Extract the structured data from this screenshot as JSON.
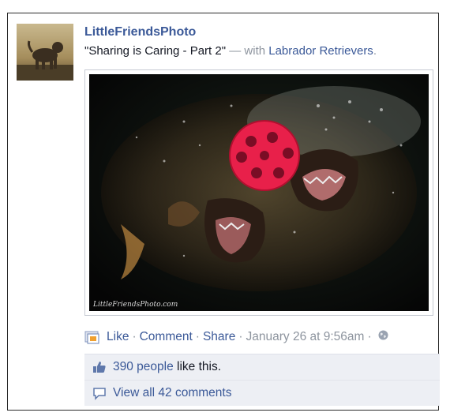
{
  "post": {
    "author": "LittleFriendsPhoto",
    "caption_quote": "\"Sharing is Caring - Part 2\"",
    "caption_with": "— with",
    "tagged_page": "Labrador Retrievers",
    "caption_end": ".",
    "photo_watermark": "LittleFriendsPhoto.com"
  },
  "actions": {
    "like": "Like",
    "comment": "Comment",
    "share": "Share",
    "separator": "·",
    "timestamp": "January 26 at 9:56am",
    "audience_icon": "globe-icon",
    "app_icon": "photo-app-icon"
  },
  "ufi": {
    "likes_link": "390 people",
    "likes_suffix": " like this.",
    "comments_link": "View all 42 comments",
    "like_icon": "thumbs-up-icon",
    "comment_icon": "comment-bubble-icon"
  },
  "colors": {
    "link": "#3b5998",
    "meta": "#8d949e",
    "ufi_bg": "#edeff4",
    "ball": "#e8204a"
  }
}
